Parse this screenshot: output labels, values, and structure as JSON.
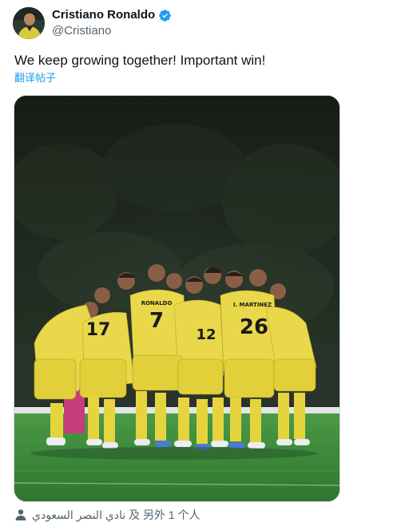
{
  "author": {
    "display_name": "Cristiano Ronaldo",
    "handle": "@Cristiano",
    "verified": true,
    "verified_icon": "verified-badge-icon",
    "verified_color": "#1d9bf0"
  },
  "post": {
    "text": "We keep growing together! Important win!",
    "translate_label": "翻译帖子"
  },
  "media": {
    "jersey_color": "#e9d84a",
    "pitch_color": "#3f8a3a",
    "jersey_names": [
      "RONALDO",
      "I. MARTINEZ"
    ],
    "jersey_numbers": [
      "7",
      "17",
      "26",
      "12"
    ]
  },
  "tagged": {
    "icon": "person-icon",
    "text": "نادي النصر السعودي 及 另外 1 个人"
  },
  "colors": {
    "link": "#1d9bf0",
    "secondary_text": "#536471",
    "primary_text": "#0f1419"
  }
}
